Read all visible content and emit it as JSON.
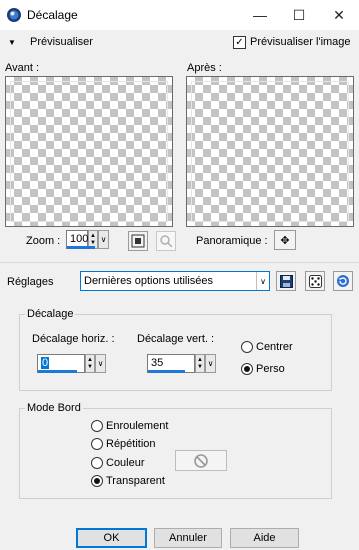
{
  "window": {
    "title": "Décalage",
    "minimize": "—",
    "maximize": "☐",
    "close": "✕"
  },
  "preview": {
    "toggle_label": "Prévisualiser",
    "checkbox_label": "Prévisualiser l'image",
    "checkbox_checked": true,
    "before_label": "Avant :",
    "after_label": "Après :",
    "zoom_label": "Zoom :",
    "zoom_value": "100",
    "panoramique_label": "Panoramique :"
  },
  "presets": {
    "label": "Réglages",
    "selected": "Dernières options utilisées"
  },
  "offset": {
    "group_label": "Décalage",
    "horiz_label": "Décalage horiz. :",
    "horiz_value": "0",
    "vert_label": "Décalage vert. :",
    "vert_value": "35",
    "options": [
      "Centrer",
      "Perso"
    ],
    "selected": "Perso"
  },
  "edge_mode": {
    "group_label": "Mode Bord",
    "options": [
      "Enroulement",
      "Répétition",
      "Couleur",
      "Transparent"
    ],
    "selected": "Transparent"
  },
  "buttons": {
    "ok": "OK",
    "cancel": "Annuler",
    "help": "Aide"
  },
  "colors": {
    "accent": "#0078d7",
    "progress_blue": "#1e78d7",
    "checker": "#c3c3c3"
  }
}
